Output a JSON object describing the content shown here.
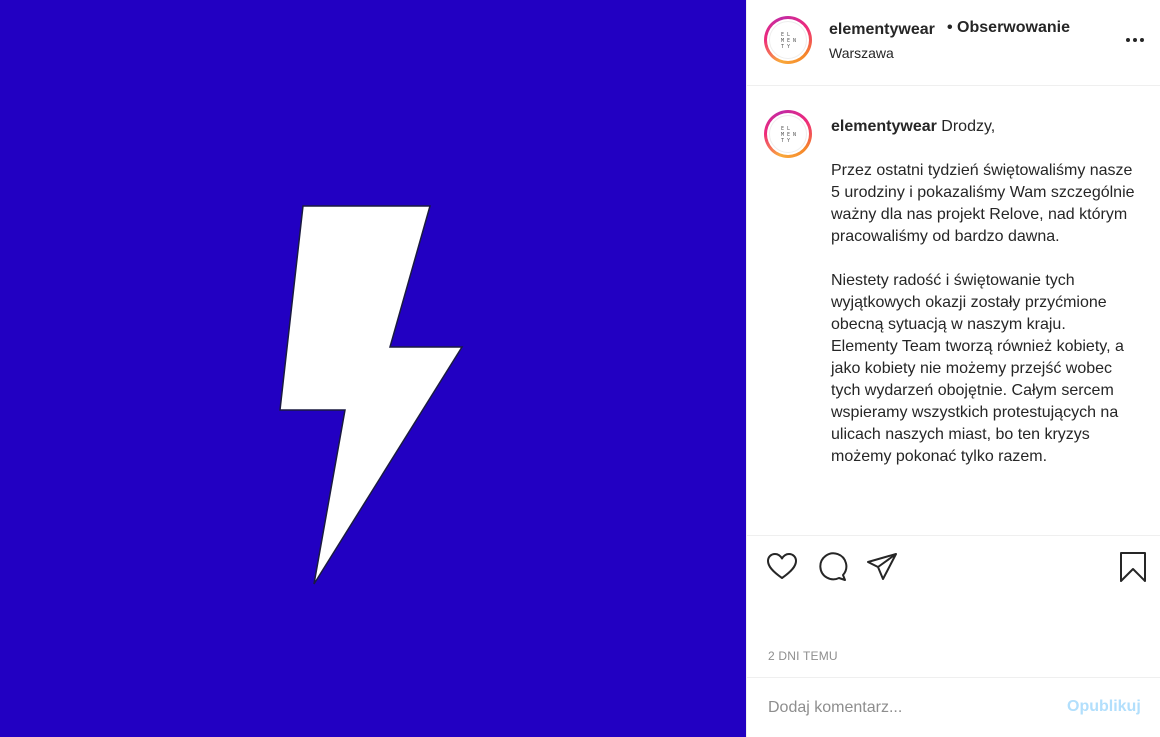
{
  "post": {
    "image": {
      "background_color": "#2200c2",
      "icon": "lightning-bolt-icon",
      "icon_color": "#ffffff"
    },
    "header": {
      "username": "elementywear",
      "follow_label": "• Obserwowanie",
      "location": "Warszawa",
      "more_icon": "more-options-icon"
    },
    "caption": {
      "username": "elementywear",
      "text": "Drodzy,\n\nPrzez ostatni tydzień świętowaliśmy nasze 5 urodziny i pokazaliśmy Wam szczególnie ważny dla nas projekt Relove, nad którym pracowaliśmy od bardzo dawna.\n\nNiestety radość i świętowanie tych wyjątkowych okazji zostały przyćmione obecną sytuacją w naszym kraju.\nElementy Team tworzą również kobiety, a jako kobiety nie możemy przejść wobec tych wydarzeń obojętnie. Całym sercem wspieramy wszystkich protestujących na ulicach naszych miast, bo ten kryzys możemy pokonać tylko razem."
    },
    "actions": {
      "like_icon": "heart-icon",
      "comment_icon": "comment-icon",
      "share_icon": "share-icon",
      "save_icon": "bookmark-icon"
    },
    "timestamp": "2 DNI TEMU",
    "comment": {
      "placeholder": "Dodaj komentarz...",
      "publish_label": "Opublikuj",
      "publish_color": "#b2dffc"
    }
  }
}
